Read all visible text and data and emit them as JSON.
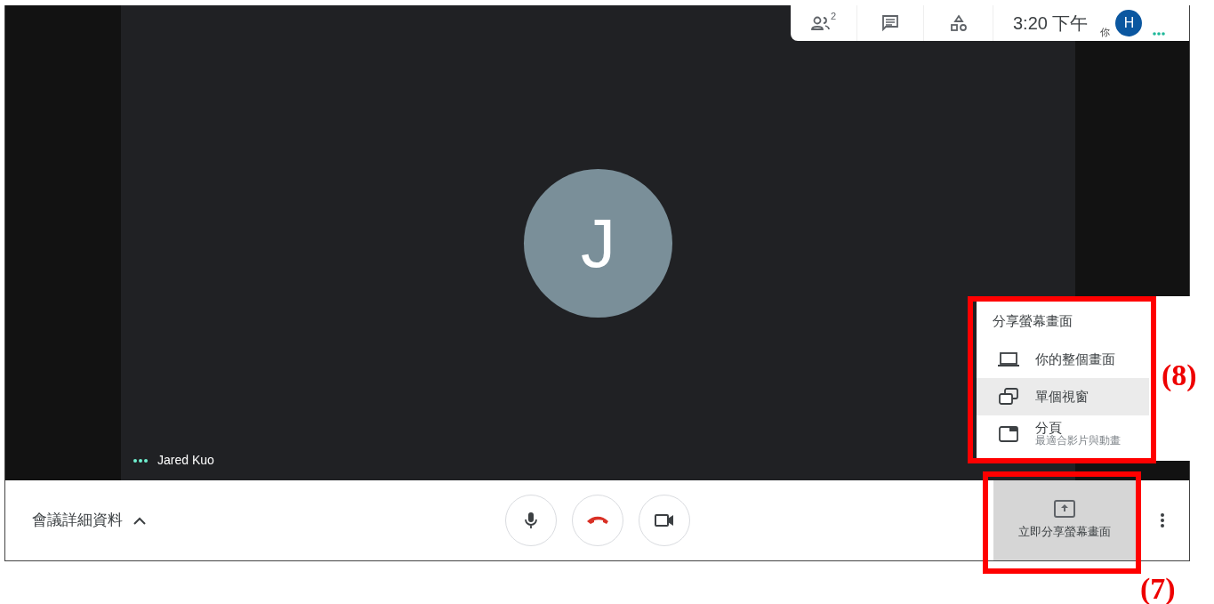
{
  "top_bar": {
    "people_count": "2",
    "time": "3:20 下午",
    "self_label": "你",
    "avatar_initial": "H"
  },
  "participant": {
    "initial": "J",
    "name": "Jared Kuo"
  },
  "share_menu": {
    "title": "分享螢幕畫面",
    "items": [
      {
        "kind": "screen",
        "label": "你的整個畫面",
        "selected": false
      },
      {
        "kind": "window",
        "label": "單個視窗",
        "selected": true
      },
      {
        "kind": "tab",
        "label": "分頁",
        "subtitle": "最適合影片與動畫",
        "selected": false
      }
    ]
  },
  "bottom_bar": {
    "meeting_details": "會議詳細資料",
    "present_button": {
      "label": "立即分享螢幕畫面",
      "active": true
    }
  },
  "annotations": [
    {
      "kind": "menu",
      "label": "(8)"
    },
    {
      "kind": "button",
      "label": "(7)"
    }
  ]
}
